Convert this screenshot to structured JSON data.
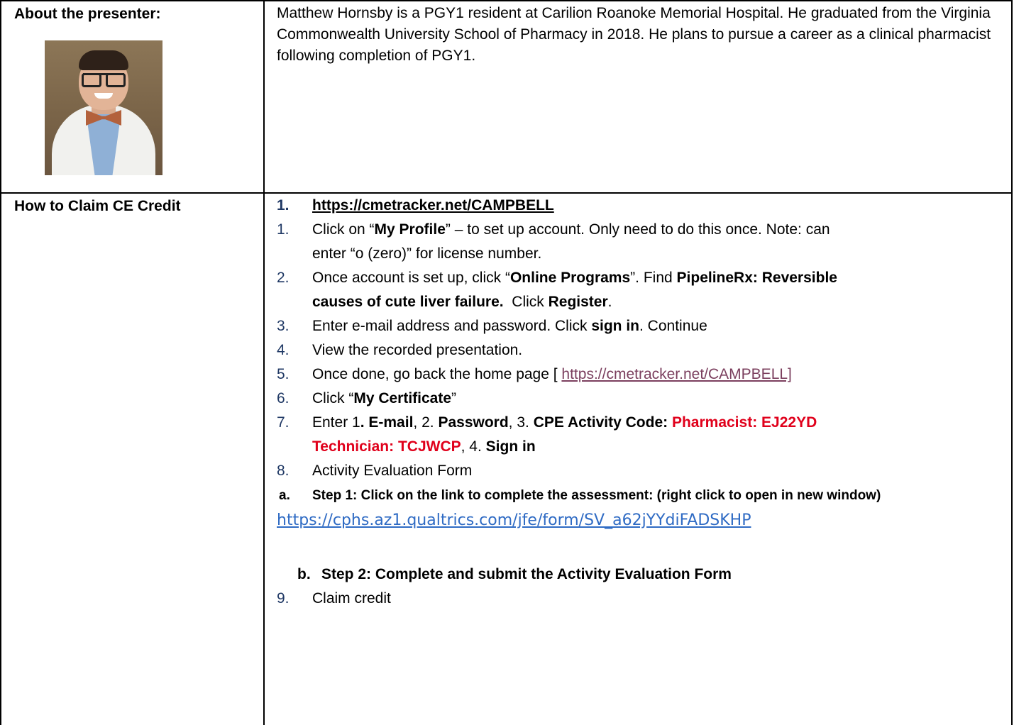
{
  "presenter": {
    "label": "About the presenter:",
    "bio": "Matthew Hornsby is a PGY1 resident at Carilion Roanoke Memorial Hospital. He graduated from the Virginia Commonwealth University School of Pharmacy in 2018. He plans to pursue a career as a clinical pharmacist following completion of PGY1."
  },
  "claim": {
    "label": "How to Claim CE Credit",
    "url_num": "1.",
    "url": "https://cmetracker.net/CAMPBELL",
    "s1_num": "1.",
    "s1_a": "Click on “",
    "s1_b": "My Profile",
    "s1_c": "” – to set up account. Only need to do this once. Note: can",
    "s1_cont": "enter “o (zero)” for license number.",
    "s2_num": "2.",
    "s2_a": "Once account is set up, click “",
    "s2_b": "Online Programs",
    "s2_c": "”. Find ",
    "s2_d": "PipelineRx: Reversible",
    "s2_cont_a": "causes of cute liver failure.",
    "s2_cont_b": "  Click ",
    "s2_cont_c": "Register",
    "s2_cont_d": ".",
    "s3_num": "3.",
    "s3_a": "Enter e-mail address and password.  Click ",
    "s3_b": "sign in",
    "s3_c": ".  Continue",
    "s4_num": "4.",
    "s4_a": "View the recorded presentation.",
    "s5_num": "5.",
    "s5_a": "Once done,  go back the home page [ ",
    "s5_link": "https://cmetracker.net/CAMPBELL]",
    "s6_num": "6.",
    "s6_a": "Click “",
    "s6_b": "My Certificate",
    "s6_c": "”",
    "s7_num": "7.",
    "s7_a": "Enter 1",
    "s7_b": ". E-mail",
    "s7_c": ", 2. ",
    "s7_d": "Password",
    "s7_e": ", 3. ",
    "s7_f": "CPE Activity Code: ",
    "s7_g": "Pharmacist: EJ22YD",
    "s7_cont_a": "Technician: TCJWCP",
    "s7_cont_b": ", 4. ",
    "s7_cont_c": "Sign in",
    "s8_num": "8.",
    "s8_a": "Activity Evaluation Form",
    "sa_num": "a.",
    "sa_text": "Step 1: Click on the link to complete the assessment: (right click to open in new window)",
    "qualtrics_url": "https://cphs.az1.qualtrics.com/jfe/form/SV_a62jYYdiFADSKHP",
    "sb_num": "b.",
    "sb_text": "Step 2: Complete and submit the Activity Evaluation Form",
    "s9_num": "9.",
    "s9_a": "Claim credit"
  }
}
